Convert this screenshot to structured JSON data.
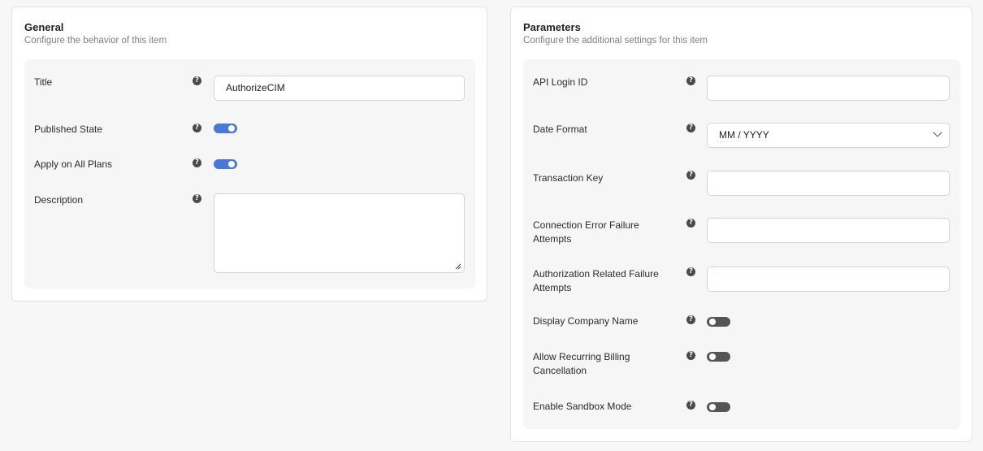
{
  "general": {
    "title": "General",
    "subtitle": "Configure the behavior of this item",
    "fields": {
      "title": {
        "label": "Title",
        "value": "AuthorizeCIM"
      },
      "published_state": {
        "label": "Published State",
        "enabled": true
      },
      "apply_all_plans": {
        "label": "Apply on All Plans",
        "enabled": true
      },
      "description": {
        "label": "Description",
        "value": ""
      }
    }
  },
  "parameters": {
    "title": "Parameters",
    "subtitle": "Configure the additional settings for this item",
    "fields": {
      "api_login_id": {
        "label": "API Login ID",
        "value": ""
      },
      "date_format": {
        "label": "Date Format",
        "value": "MM / YYYY"
      },
      "transaction_key": {
        "label": "Transaction Key",
        "value": ""
      },
      "connection_error": {
        "label": "Connection Error Failure Attempts",
        "value": ""
      },
      "authorization_failure": {
        "label": "Authorization Related Failure Attempts",
        "value": ""
      },
      "display_company_name": {
        "label": "Display Company Name",
        "enabled": false
      },
      "allow_recurring_cancel": {
        "label": "Allow Recurring Billing Cancellation",
        "enabled": false
      },
      "enable_sandbox": {
        "label": "Enable Sandbox Mode",
        "enabled": false
      }
    }
  },
  "icons": {
    "help": "question-circle-icon",
    "help_glyph": "?"
  },
  "colors": {
    "toggle_on": "#4a78d8",
    "toggle_off": "#555555",
    "page_bg": "#f7f7f7",
    "panel_bg": "#f6f6f6"
  }
}
